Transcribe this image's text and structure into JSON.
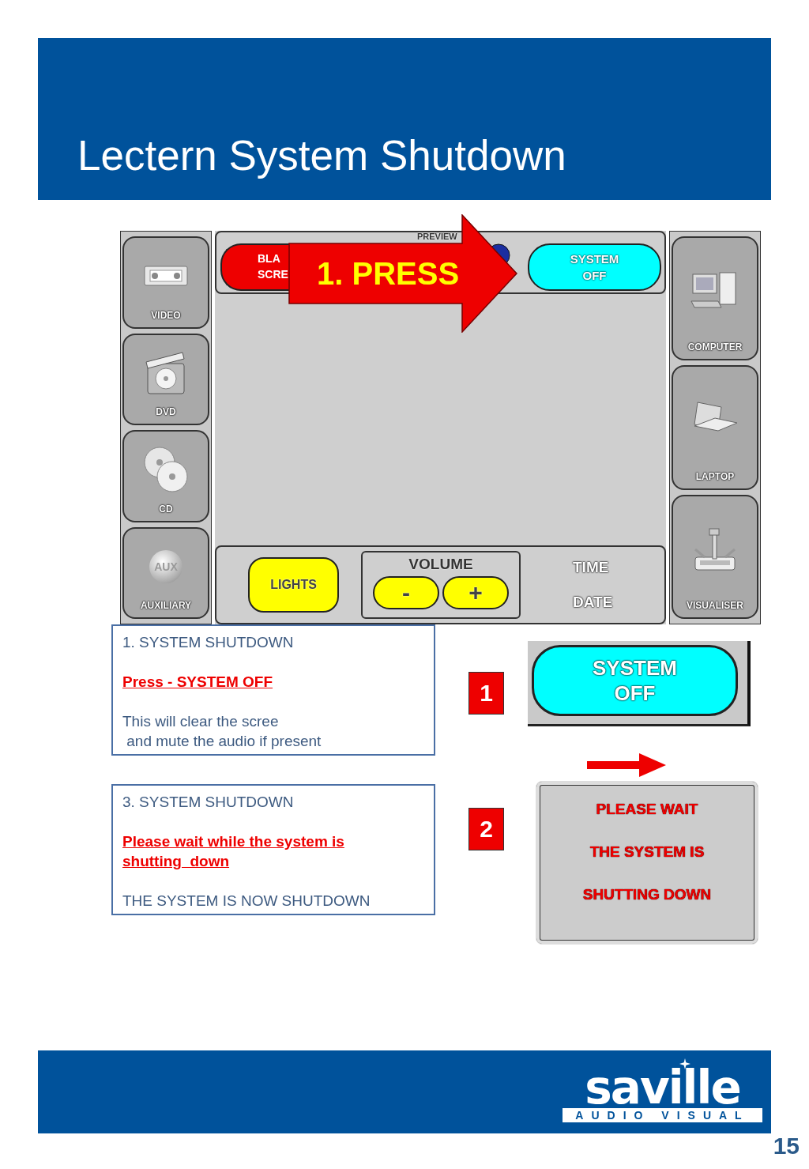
{
  "header": {
    "title": "Lectern System Shutdown"
  },
  "panel": {
    "left_sources": [
      {
        "label": "VIDEO"
      },
      {
        "label": "DVD"
      },
      {
        "label": "CD"
      },
      {
        "label": "AUXILIARY",
        "icon_text": "AUX"
      }
    ],
    "top_bar": {
      "preview_label": "PREVIEW",
      "blank_button": "BLA\nSCRE",
      "off_button": "SYSTEM\nOFF"
    },
    "bottom_bar": {
      "lights_button": "LIGHTS",
      "volume_label": "VOLUME",
      "volume_down": "-",
      "volume_up": "+",
      "time_label": "TIME",
      "date_label": "DATE"
    },
    "right_sources": [
      {
        "label": "COMPUTER"
      },
      {
        "label": "LAPTOP"
      },
      {
        "label": "VISUALISER"
      }
    ]
  },
  "callout": {
    "text": "1. PRESS"
  },
  "steps": [
    {
      "title": "1. SYSTEM SHUTDOWN",
      "action": "Press - SYSTEM OFF",
      "text": "This will clear the scree\n and mute the audio if present",
      "badge": "1",
      "arrow_before": false,
      "preview": {
        "kind": "off_button",
        "text": "SYSTEM\nOFF"
      }
    },
    {
      "title": "3. SYSTEM SHUTDOWN",
      "action": "Please wait while the system is\nshutting  down",
      "text": "THE SYSTEM IS NOW SHUTDOWN",
      "badge": "2",
      "arrow_before": true,
      "preview": {
        "kind": "wait_message",
        "lines": [
          "PLEASE WAIT",
          "THE SYSTEM IS",
          "SHUTTING DOWN"
        ]
      }
    }
  ],
  "footer": {
    "logo_name": "saville",
    "logo_tagline": "AUDIO VISUAL",
    "page_number": "15"
  }
}
